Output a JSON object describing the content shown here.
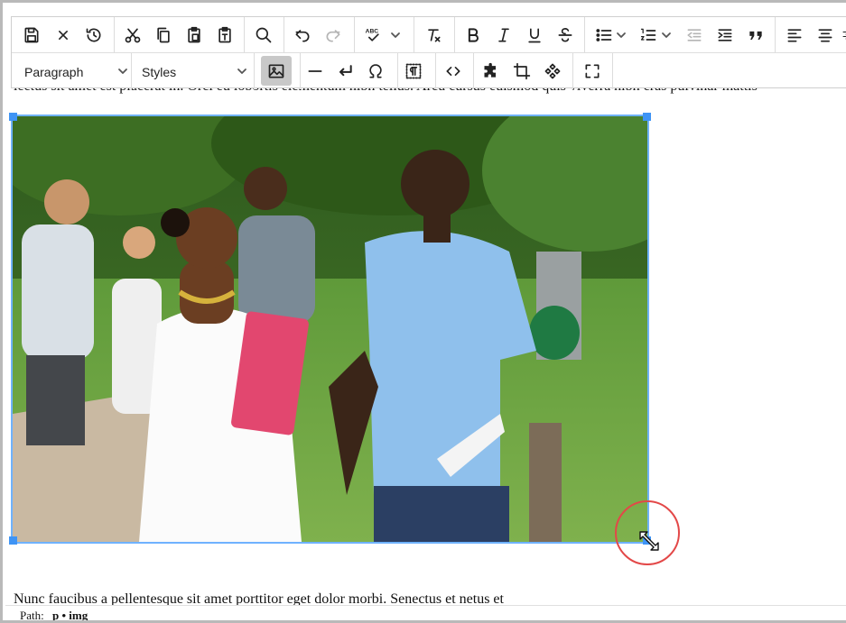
{
  "toolbar": {
    "row1": [
      {
        "name": "save-icon"
      },
      {
        "name": "close-icon"
      },
      {
        "name": "history-icon"
      },
      {
        "name": "cut-icon"
      },
      {
        "name": "copy-icon"
      },
      {
        "name": "paste-icon"
      },
      {
        "name": "paste-text-icon"
      },
      {
        "name": "search-icon"
      },
      {
        "name": "undo-icon"
      },
      {
        "name": "redo-icon",
        "disabled": true
      },
      {
        "name": "spellcheck-icon"
      },
      {
        "name": "clear-format-icon"
      },
      {
        "name": "bold-icon"
      },
      {
        "name": "italic-icon"
      },
      {
        "name": "underline-icon"
      },
      {
        "name": "strikethrough-icon"
      },
      {
        "name": "bullet-list-icon"
      },
      {
        "name": "numbered-list-icon"
      },
      {
        "name": "outdent-icon"
      },
      {
        "name": "indent-icon"
      },
      {
        "name": "blockquote-icon"
      },
      {
        "name": "align-left-icon"
      },
      {
        "name": "align-center-icon"
      },
      {
        "name": "align-right-icon"
      }
    ],
    "format_select": "Paragraph",
    "styles_select": "Styles",
    "row2": [
      {
        "name": "image-icon",
        "active": true
      },
      {
        "name": "horizontal-rule-icon"
      },
      {
        "name": "line-break-icon"
      },
      {
        "name": "special-char-icon"
      },
      {
        "name": "show-blocks-icon"
      },
      {
        "name": "source-code-icon"
      },
      {
        "name": "plugin-icon"
      },
      {
        "name": "crop-icon"
      },
      {
        "name": "components-icon"
      },
      {
        "name": "fullscreen-icon"
      }
    ]
  },
  "content": {
    "paragraph_top": "lectus sit amet est placerat in. Orci eu lobortis elementum nibh tellus. Arcu cursus euismod quis viverra nibh cras pulvinar mattis",
    "paragraph_bottom": "Nunc faucibus a pellentesque sit amet porttitor eget dolor morbi. Senectus et netus et"
  },
  "statusbar": {
    "label": "Path:",
    "path": "p • img"
  },
  "colors": {
    "selection_outline": "#6fb2ff",
    "handle": "#3f94f5",
    "annotation_circle": "#e34848"
  }
}
